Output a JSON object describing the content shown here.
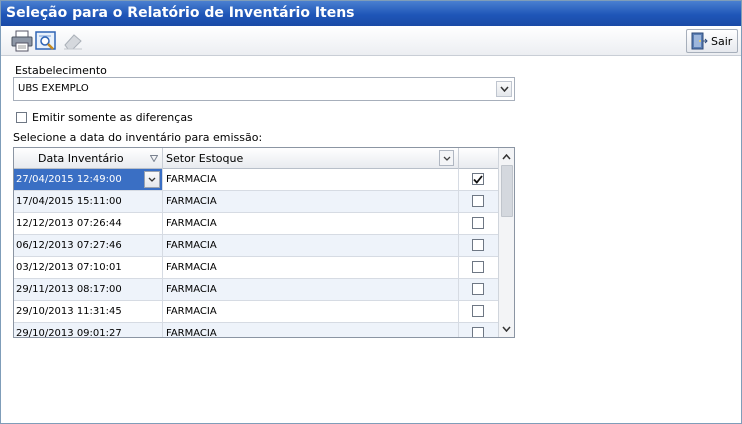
{
  "window": {
    "title": "Seleção para o Relatório de Inventário Itens"
  },
  "toolbar": {
    "print_icon": "printer-icon",
    "preview_icon": "print-preview-icon",
    "clear_icon": "eraser-icon",
    "exit_label": "Sair",
    "exit_icon": "exit-door-icon"
  },
  "form": {
    "establishment_label": "Estabelecimento",
    "establishment_value": "UBS EXEMPLO",
    "only_differences_label": "Emitir somente as diferenças",
    "only_differences_checked": false,
    "select_date_label": "Selecione a data do inventário para emissão:"
  },
  "grid": {
    "columns": [
      "Data Inventário",
      "Setor Estoque"
    ],
    "rows": [
      {
        "date": "27/04/2015 12:49:00",
        "sector": "FARMACIA",
        "checked": true
      },
      {
        "date": "17/04/2015 15:11:00",
        "sector": "FARMACIA",
        "checked": false
      },
      {
        "date": "12/12/2013 07:26:44",
        "sector": "FARMACIA",
        "checked": false
      },
      {
        "date": "06/12/2013 07:27:46",
        "sector": "FARMACIA",
        "checked": false
      },
      {
        "date": "03/12/2013 07:10:01",
        "sector": "FARMACIA",
        "checked": false
      },
      {
        "date": "29/11/2013 08:17:00",
        "sector": "FARMACIA",
        "checked": false
      },
      {
        "date": "29/10/2013 11:31:45",
        "sector": "FARMACIA",
        "checked": false
      },
      {
        "date": "29/10/2013 09:01:27",
        "sector": "FARMACIA",
        "checked": false
      }
    ]
  },
  "colors": {
    "title_bar": "#1f56b8",
    "selection": "#3a6fc4",
    "alt_row": "#eef3fa"
  }
}
